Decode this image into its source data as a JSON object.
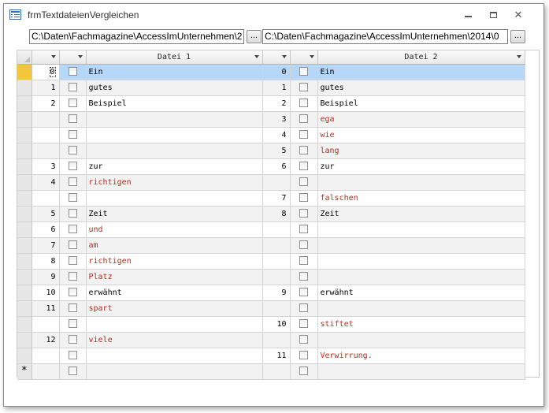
{
  "window": {
    "title": "frmTextdateienVergleichen"
  },
  "paths": {
    "file1": "C:\\Daten\\Fachmagazine\\AccessImUnternehmen\\2",
    "file2": "C:\\Daten\\Fachmagazine\\AccessImUnternehmen\\2014\\0",
    "browse_label": "..."
  },
  "grid": {
    "header_file1": "Datei 1",
    "header_file2": "Datei 2",
    "new_row_marker": "*",
    "rows": [
      {
        "n1": "0",
        "t1": "Ein",
        "r1": false,
        "n2": "0",
        "t2": "Ein",
        "r2": false
      },
      {
        "n1": "1",
        "t1": "gutes",
        "r1": false,
        "n2": "1",
        "t2": "gutes",
        "r2": false
      },
      {
        "n1": "2",
        "t1": "Beispiel",
        "r1": false,
        "n2": "2",
        "t2": "Beispiel",
        "r2": false
      },
      {
        "n1": "",
        "t1": "",
        "r1": false,
        "n2": "3",
        "t2": "ega",
        "r2": true
      },
      {
        "n1": "",
        "t1": "",
        "r1": false,
        "n2": "4",
        "t2": "wie",
        "r2": true
      },
      {
        "n1": "",
        "t1": "",
        "r1": false,
        "n2": "5",
        "t2": "lang",
        "r2": true
      },
      {
        "n1": "3",
        "t1": "zur",
        "r1": false,
        "n2": "6",
        "t2": "zur",
        "r2": false
      },
      {
        "n1": "4",
        "t1": "richtigen",
        "r1": true,
        "n2": "",
        "t2": "",
        "r2": false
      },
      {
        "n1": "",
        "t1": "",
        "r1": false,
        "n2": "7",
        "t2": "falschen",
        "r2": true
      },
      {
        "n1": "5",
        "t1": "Zeit",
        "r1": false,
        "n2": "8",
        "t2": "Zeit",
        "r2": false
      },
      {
        "n1": "6",
        "t1": "und",
        "r1": true,
        "n2": "",
        "t2": "",
        "r2": false
      },
      {
        "n1": "7",
        "t1": "am",
        "r1": true,
        "n2": "",
        "t2": "",
        "r2": false
      },
      {
        "n1": "8",
        "t1": "richtigen",
        "r1": true,
        "n2": "",
        "t2": "",
        "r2": false
      },
      {
        "n1": "9",
        "t1": "Platz",
        "r1": true,
        "n2": "",
        "t2": "",
        "r2": false
      },
      {
        "n1": "10",
        "t1": "erwähnt",
        "r1": false,
        "n2": "9",
        "t2": "erwähnt",
        "r2": false
      },
      {
        "n1": "11",
        "t1": "spart",
        "r1": true,
        "n2": "",
        "t2": "",
        "r2": false
      },
      {
        "n1": "",
        "t1": "",
        "r1": false,
        "n2": "10",
        "t2": "stiftet",
        "r2": true
      },
      {
        "n1": "12",
        "t1": "viele",
        "r1": true,
        "n2": "",
        "t2": "",
        "r2": false
      },
      {
        "n1": "",
        "t1": "",
        "r1": false,
        "n2": "11",
        "t2": "Verwirrung.",
        "r2": true
      }
    ]
  },
  "colors": {
    "diff_text": "#c1271c",
    "selected_row": "#b7d7f8",
    "record_selector_active": "#f4c63d"
  }
}
